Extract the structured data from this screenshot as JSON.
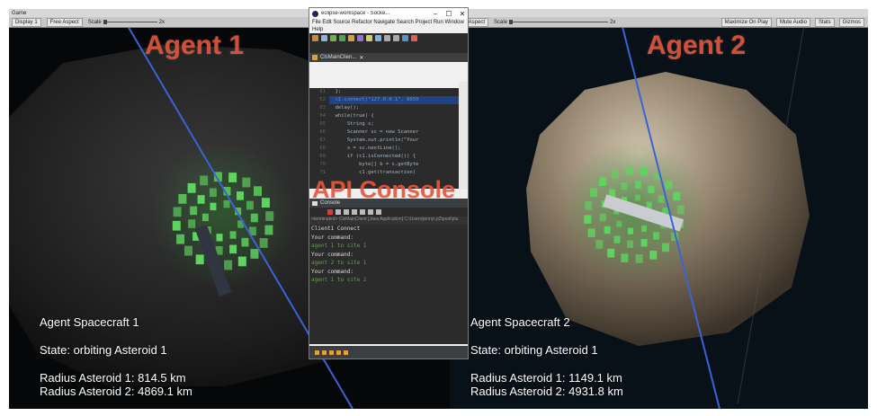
{
  "left_window": {
    "tab_label": "Game",
    "display_label": "Display 1",
    "aspect_label": "Free Aspect",
    "scale_label": "Scale",
    "scale_value": "2x",
    "overlay_title": "Agent 1",
    "hud": {
      "name": "Agent Spacecraft 1",
      "state": "State: orbiting Asteroid 1",
      "radius1": "Radius Asteroid 1: 814.5 km",
      "radius2": "Radius Asteroid 2: 4869.1 km"
    }
  },
  "right_window": {
    "aspect_label": "Free Aspect",
    "scale_label": "Scale",
    "scale_value": "2x",
    "buttons": [
      "Maximize On Play",
      "Mute Audio",
      "Stats",
      "Gizmos"
    ],
    "overlay_title": "Agent 2",
    "hud": {
      "name": "Agent Spacecraft 2",
      "state": "State: orbiting Asteroid 1",
      "radius1": "Radius Asteroid 1: 1149.1 km",
      "radius2": "Radius Asteroid 2: 4931.8 km"
    }
  },
  "ide": {
    "title": "eclipse-workspace - Socke...",
    "window_controls": [
      "–",
      "☐",
      "✕"
    ],
    "menu": [
      "File",
      "Edit",
      "Source",
      "Refactor",
      "Navigate",
      "Search",
      "Project",
      "Run",
      "Window",
      "Help"
    ],
    "editor_tab": "ClsMainClien...",
    "code_lines": [
      {
        "n": "61",
        "t": "  };"
      },
      {
        "n": "62",
        "t": "  c1.connect(\"127.0.0.1\", 8050",
        "sel": true
      },
      {
        "n": "63",
        "t": "  delay();"
      },
      {
        "n": "64",
        "t": "  while(true) {"
      },
      {
        "n": "65",
        "t": "      String s;"
      },
      {
        "n": "66",
        "t": "      Scanner sc = new Scanner"
      },
      {
        "n": "67",
        "t": "      System.out.println(\"Your"
      },
      {
        "n": "68",
        "t": "      s = sc.nextLine();"
      },
      {
        "n": "69",
        "t": "      if (c1.isConnected()) {"
      },
      {
        "n": "70",
        "t": "          byte[] b = s.getByte"
      },
      {
        "n": "71",
        "t": "          c1.get(transaction)"
      }
    ],
    "console_tab": "Console",
    "console_header": "<terminated> ClsMainClient [Java Application] C:\\Users\\jenny\\.p2\\pool\\plu",
    "console_lines": [
      {
        "t": "Client1 Connect",
        "in": false
      },
      {
        "t": "Your command:",
        "in": false
      },
      {
        "t": "agent 1 to site 1",
        "in": true
      },
      {
        "t": "Your command:",
        "in": false
      },
      {
        "t": "agent 2 to site 1",
        "in": true
      },
      {
        "t": "Your command:",
        "in": false
      },
      {
        "t": "agent 1 to site 2",
        "in": true
      }
    ],
    "overlay_title": "API Console"
  },
  "colors": {
    "label_red": "#e8573c",
    "lidar_green": "#5fd35f",
    "axis_blue": "#3b63d6"
  }
}
